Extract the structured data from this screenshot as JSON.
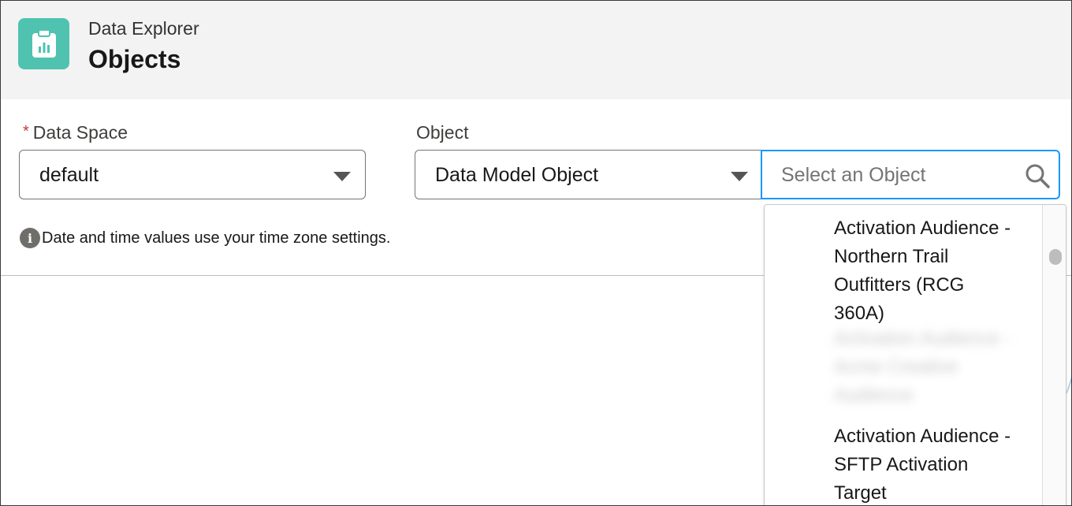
{
  "header": {
    "app_subtitle": "Data Explorer",
    "app_title": "Objects",
    "icon": "clipboard-chart-icon",
    "icon_color": "#4fc3b0"
  },
  "filters": {
    "data_space": {
      "required_mark": "*",
      "label": "Data Space",
      "value": "default"
    },
    "object": {
      "label": "Object",
      "type_value": "Data Model Object",
      "search_placeholder": "Select an Object"
    }
  },
  "info": {
    "text": "Date and time values use your time zone settings."
  },
  "dropdown": {
    "options": [
      {
        "label": "Activation Audience - Northern Trail Outfitters (RCG 360A)",
        "blurred": false
      },
      {
        "label": "Activation Audience - Acme Creative Audience",
        "blurred": true
      },
      {
        "label": "Activation Audience - SFTP Activation Target",
        "blurred": false
      }
    ]
  },
  "colors": {
    "accent_focus": "#1b96ff",
    "required": "#c23934",
    "header_bg": "#f3f3f3"
  }
}
